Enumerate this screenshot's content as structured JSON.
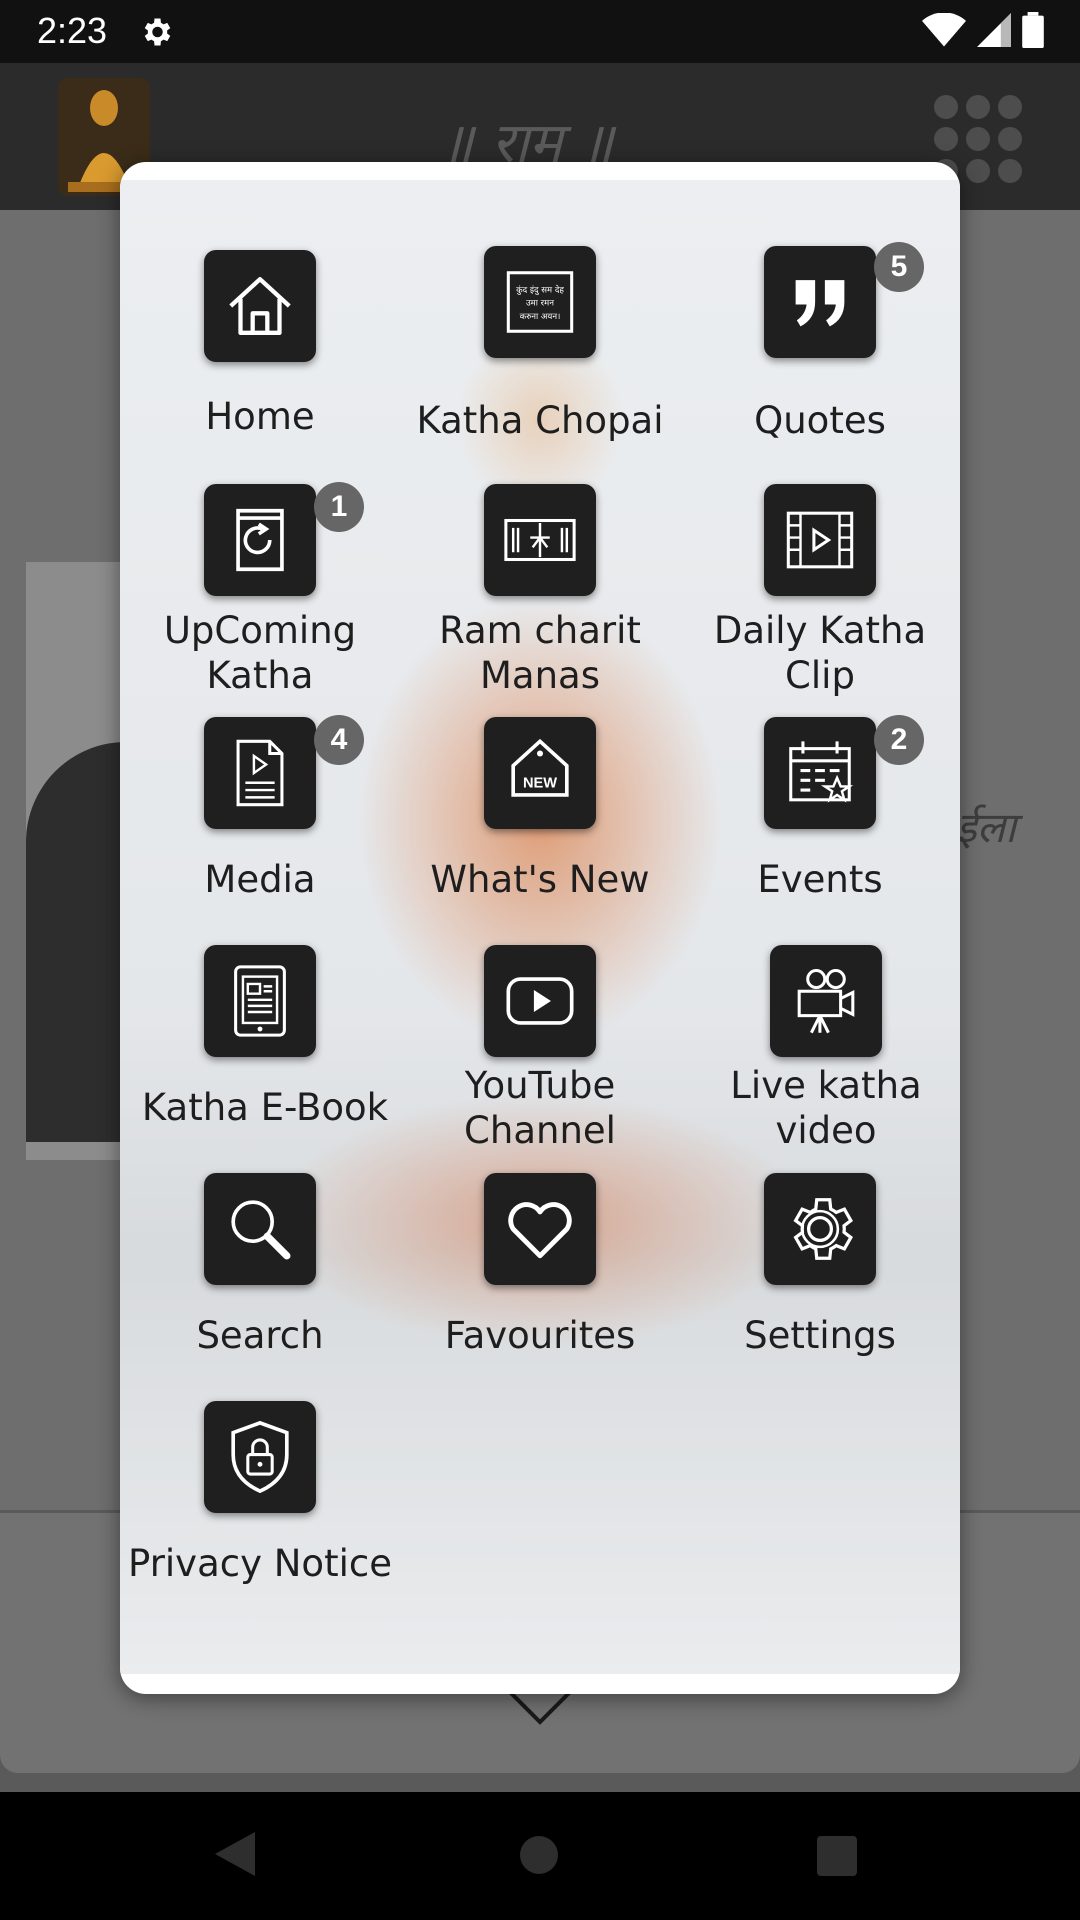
{
  "status": {
    "time": "2:23"
  },
  "header": {
    "title": "॥ राम ॥"
  },
  "background": {
    "side_text": "ईला"
  },
  "menu": {
    "items": [
      {
        "label": "Home",
        "icon": "home-icon"
      },
      {
        "label": "Katha Chopai",
        "icon": "katha-chopai-icon",
        "icon_text": [
          "कुंद इंदु सम देह",
          "उमा रमन",
          "करुना अयन।"
        ]
      },
      {
        "label": "Quotes",
        "icon": "quote-icon",
        "badge": "5"
      },
      {
        "label": "UpComing\nKatha",
        "icon": "upcoming-book-icon",
        "badge": "1"
      },
      {
        "label": "Ram charit\nManas",
        "icon": "ramcharit-icon"
      },
      {
        "label": "Daily Katha\nClip",
        "icon": "video-clip-icon"
      },
      {
        "label": "Media",
        "icon": "document-play-icon",
        "badge": "4"
      },
      {
        "label": "What's New",
        "icon": "new-tag-icon",
        "icon_text": "NEW"
      },
      {
        "label": "Events",
        "icon": "calendar-star-icon",
        "badge": "2"
      },
      {
        "label": "Katha E-Book",
        "icon": "ebook-icon"
      },
      {
        "label": "YouTube\nChannel",
        "icon": "youtube-icon"
      },
      {
        "label": "Live katha\nvideo",
        "icon": "camera-icon"
      },
      {
        "label": "Search",
        "icon": "search-icon"
      },
      {
        "label": "Favourites",
        "icon": "heart-icon"
      },
      {
        "label": "Settings",
        "icon": "gear-icon"
      },
      {
        "label": "Privacy Notice",
        "icon": "shield-lock-icon"
      }
    ]
  }
}
